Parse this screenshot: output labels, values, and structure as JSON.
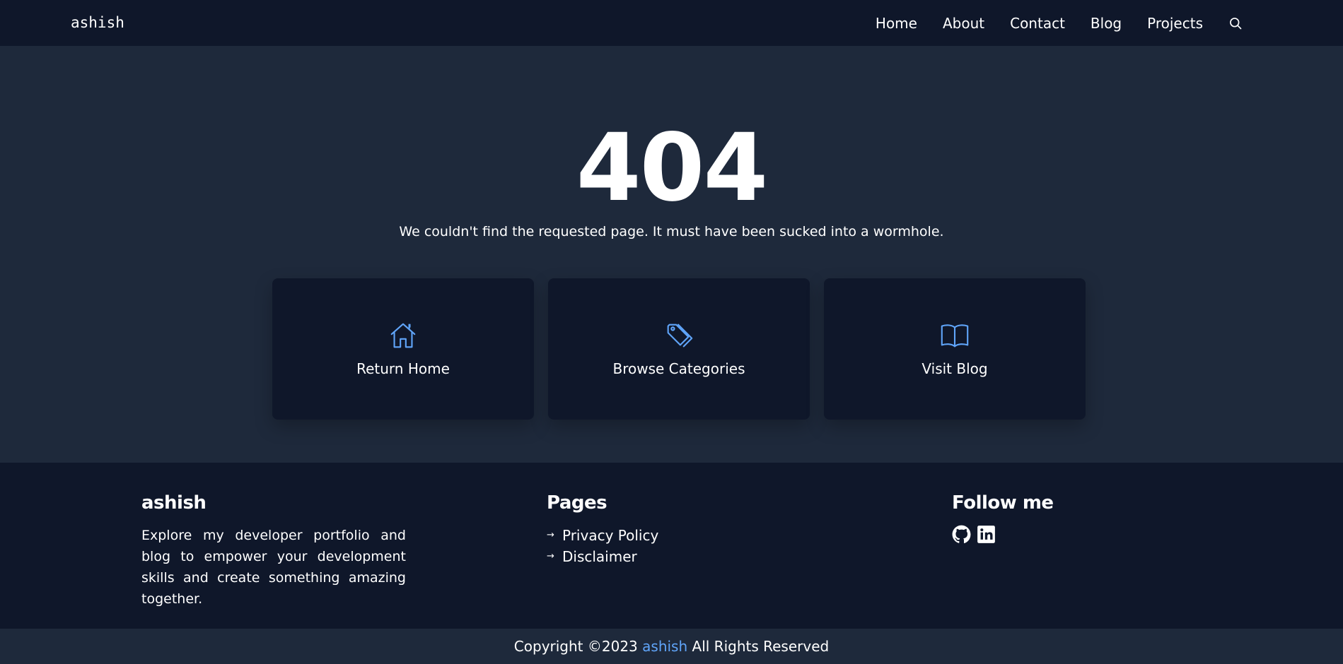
{
  "header": {
    "brand": "ashish",
    "nav": [
      "Home",
      "About",
      "Contact",
      "Blog",
      "Projects"
    ],
    "search_icon": "search-icon"
  },
  "error": {
    "code": "404",
    "message": "We couldn't find the requested page. It must have been sucked into a wormhole."
  },
  "cards": [
    {
      "label": "Return Home",
      "icon": "home-icon"
    },
    {
      "label": "Browse Categories",
      "icon": "tag-icon"
    },
    {
      "label": "Visit Blog",
      "icon": "book-icon"
    }
  ],
  "footer": {
    "about": {
      "title": "ashish",
      "text": "Explore my developer portfolio and blog to empower your development skills and create something amazing together."
    },
    "pages": {
      "title": "Pages",
      "links": [
        "Privacy Policy",
        "Disclaimer"
      ]
    },
    "follow": {
      "title": "Follow me",
      "icons": [
        "github-icon",
        "linkedin-icon"
      ]
    }
  },
  "copyright": {
    "prefix": "Copyright ©2023",
    "name": "ashish",
    "suffix": "All Rights Reserved"
  },
  "colors": {
    "nav_bg": "#0f172a",
    "page_bg": "#1e293b",
    "accent": "#60a5fa"
  }
}
